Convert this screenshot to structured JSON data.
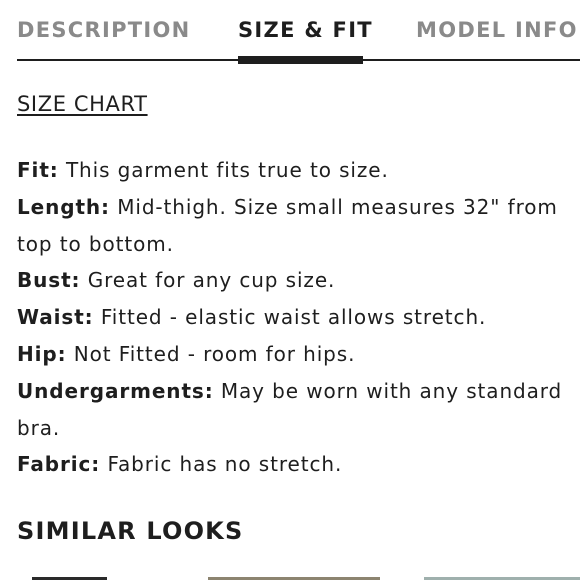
{
  "tabs": [
    {
      "label": "DESCRIPTION",
      "active": false
    },
    {
      "label": "SIZE & FIT",
      "active": true
    },
    {
      "label": "MODEL INFO",
      "active": false
    }
  ],
  "size_chart_link": "SIZE CHART",
  "details": [
    {
      "label": "Fit:",
      "text": " This garment fits true to size."
    },
    {
      "label": "Length:",
      "text": " Mid-thigh. Size small measures 32\" from top to bottom."
    },
    {
      "label": "Bust:",
      "text": " Great for any cup size."
    },
    {
      "label": "Waist:",
      "text": " Fitted - elastic waist allows stretch."
    },
    {
      "label": "Hip:",
      "text": " Not Fitted - room for hips."
    },
    {
      "label": "Undergarments:",
      "text": " May be worn with any standard bra."
    },
    {
      "label": "Fabric:",
      "text": " Fabric has no stretch."
    }
  ],
  "similar_looks_heading": "SIMILAR LOOKS",
  "colors": {
    "text": "#1e1e1e",
    "inactive_tab": "#8a8a8a",
    "background": "#ffffff"
  }
}
